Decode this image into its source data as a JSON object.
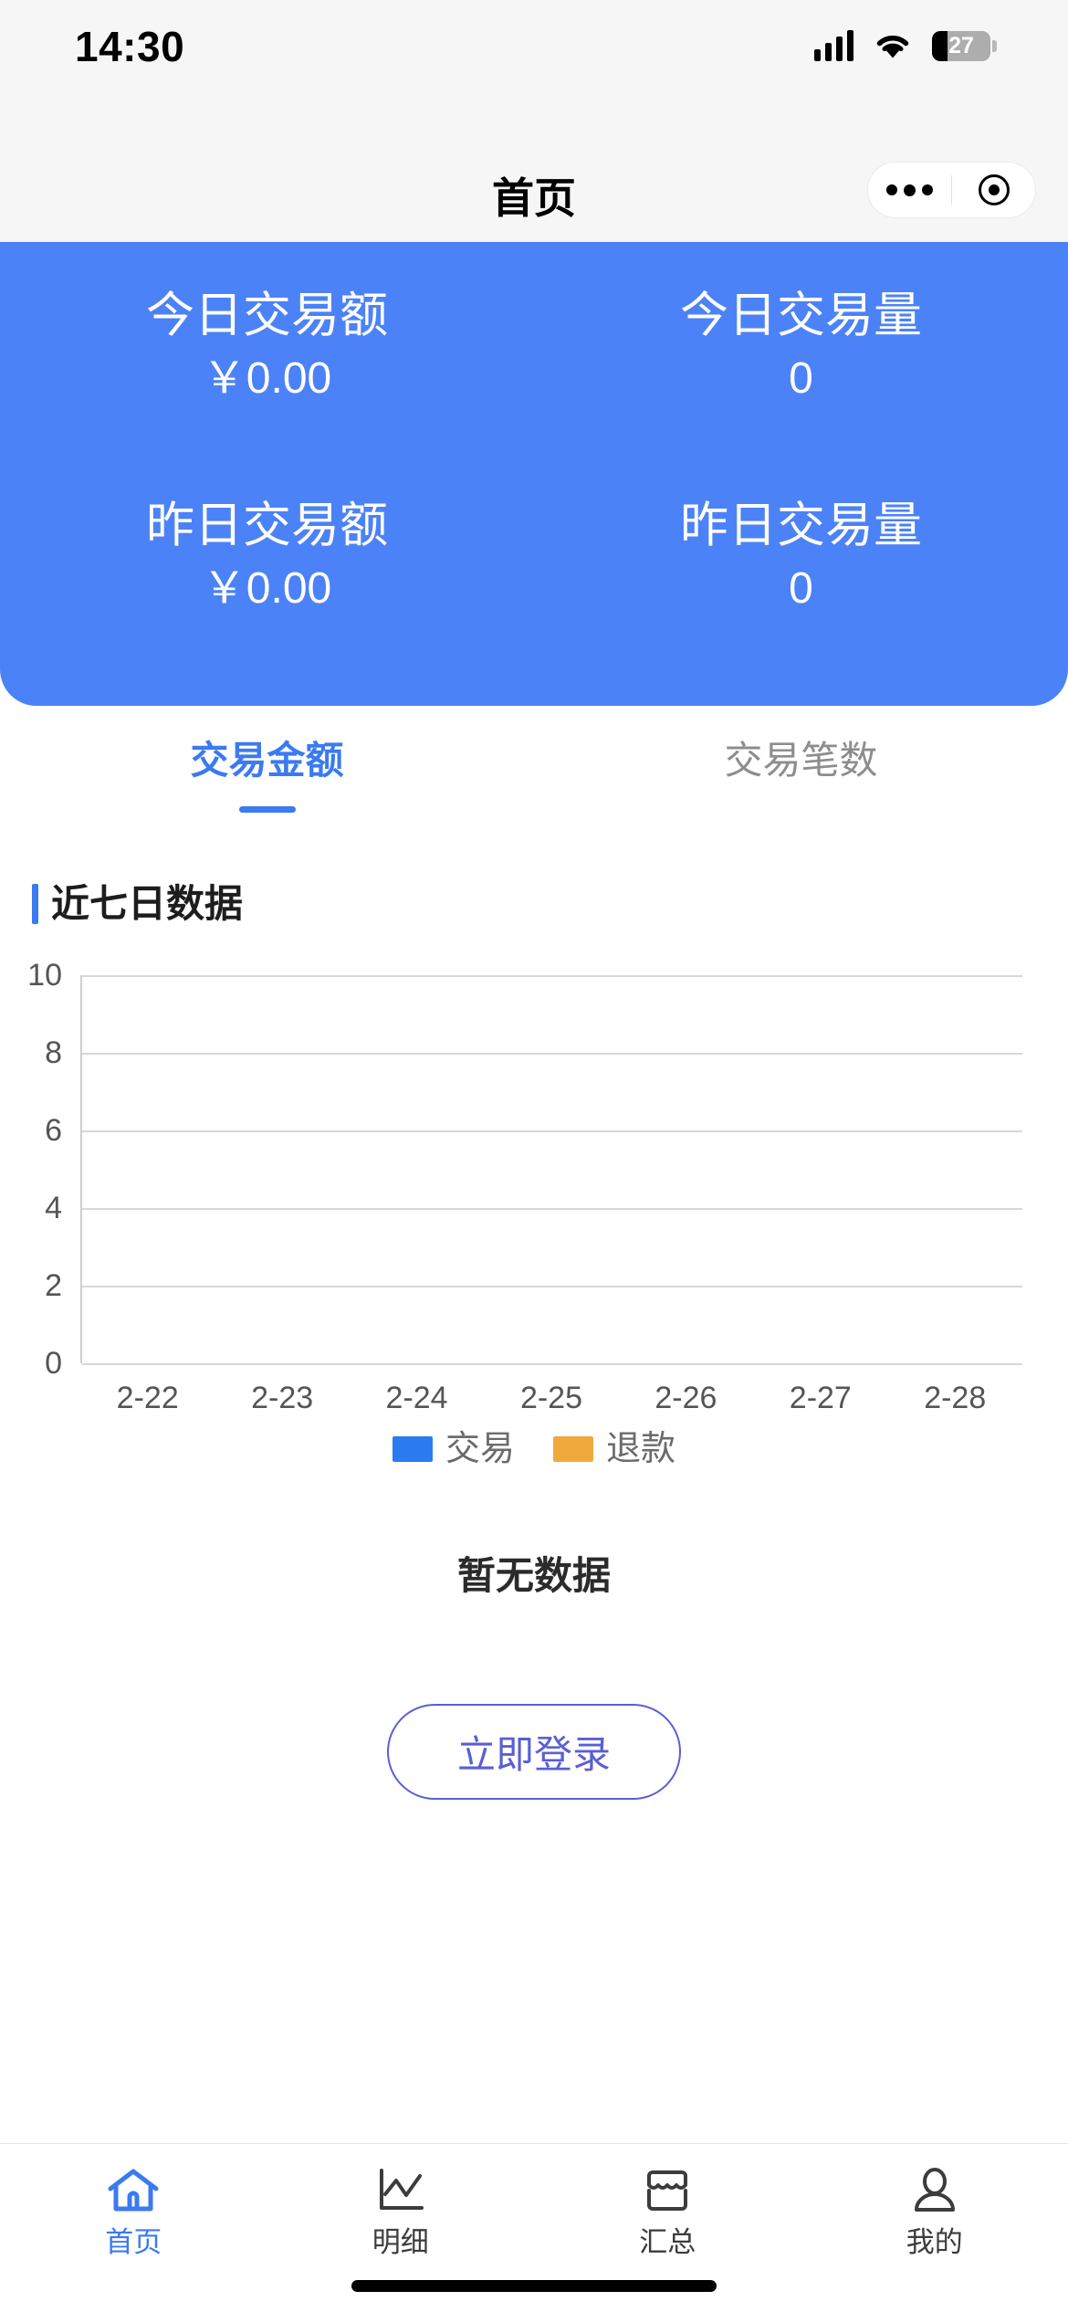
{
  "status_bar": {
    "time": "14:30",
    "battery_percent": "27",
    "signal_icon": "cellular-signal-icon",
    "wifi_icon": "wifi-icon",
    "battery_icon": "battery-icon"
  },
  "nav": {
    "title": "首页",
    "capsule": {
      "more_icon": "more-dots-icon",
      "target_icon": "mini-program-target-icon"
    }
  },
  "stats_card": {
    "accent_color": "#4c82f7",
    "items": [
      {
        "label": "今日交易额",
        "value": "￥0.00"
      },
      {
        "label": "今日交易量",
        "value": "0"
      },
      {
        "label": "昨日交易额",
        "value": "￥0.00"
      },
      {
        "label": "昨日交易量",
        "value": "0"
      }
    ]
  },
  "segment_tabs": {
    "active_index": 0,
    "active_color": "#3b7af0",
    "inactive_color": "#8d8d8d",
    "items": [
      {
        "label": "交易金额"
      },
      {
        "label": "交易笔数"
      }
    ]
  },
  "section": {
    "title": "近七日数据"
  },
  "chart_data": {
    "type": "bar",
    "title": "近七日数据",
    "categories": [
      "2-22",
      "2-23",
      "2-24",
      "2-25",
      "2-26",
      "2-27",
      "2-28"
    ],
    "series": [
      {
        "name": "交易",
        "color": "#2a7bf0",
        "values": [
          0,
          0,
          0,
          0,
          0,
          0,
          0
        ]
      },
      {
        "name": "退款",
        "color": "#f0a93c",
        "values": [
          0,
          0,
          0,
          0,
          0,
          0,
          0
        ]
      }
    ],
    "yticks": [
      "10",
      "8",
      "6",
      "4",
      "2",
      "0"
    ],
    "ylim": [
      0,
      10
    ],
    "xlabel": "",
    "ylabel": "",
    "grid": true,
    "legend_position": "bottom"
  },
  "empty_state": {
    "text": "暂无数据",
    "login_button": "立即登录",
    "login_color": "#5a5fd4"
  },
  "tab_bar": {
    "active_index": 0,
    "active_color": "#3b7af0",
    "items": [
      {
        "label": "首页",
        "icon": "home-icon"
      },
      {
        "label": "明细",
        "icon": "line-chart-icon"
      },
      {
        "label": "汇总",
        "icon": "store-awning-icon"
      },
      {
        "label": "我的",
        "icon": "person-icon"
      }
    ]
  }
}
